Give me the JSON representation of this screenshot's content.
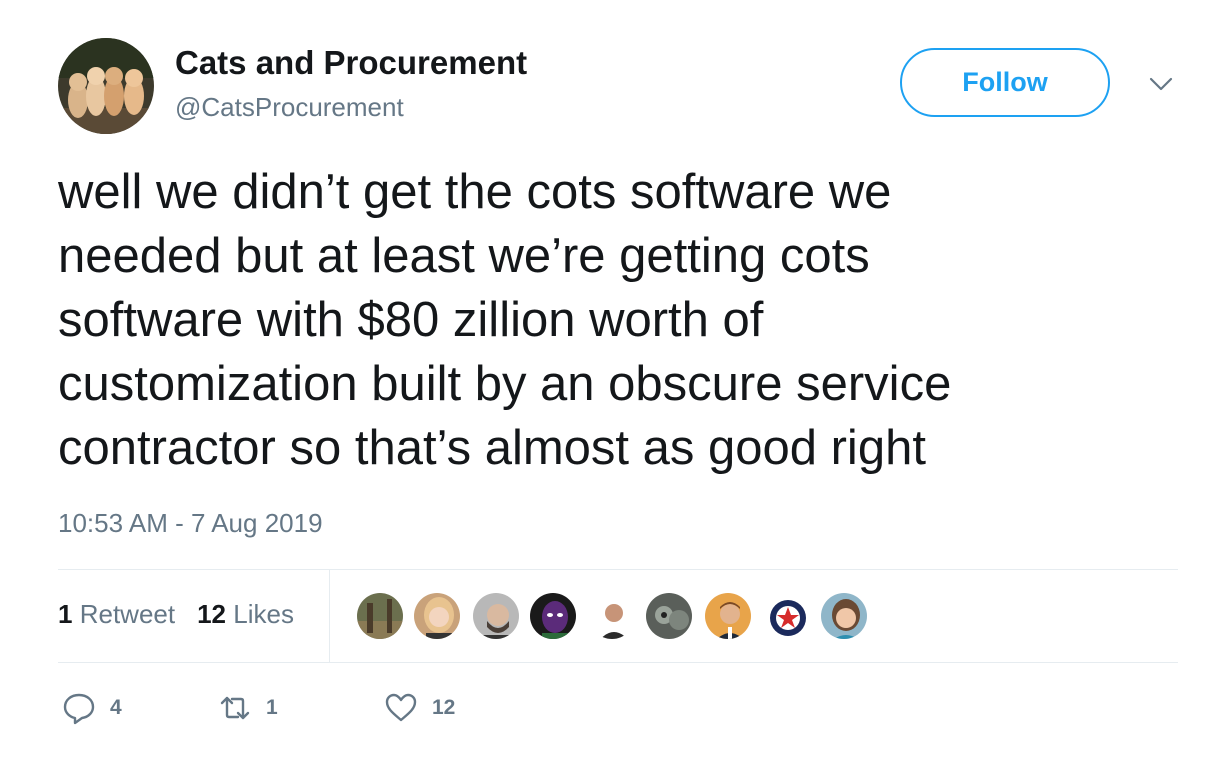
{
  "tweet": {
    "author": {
      "display_name": "Cats and Procurement",
      "handle": "@CatsProcurement",
      "avatar_icon": "cats-avatar-photo"
    },
    "follow_label": "Follow",
    "menu_icon": "chevron-down-icon",
    "text_lines": [
      "well we didn’t get the cots software we",
      "needed but at least we’re getting cots",
      "software with $80 zillion worth of",
      "customization built by an obscure service",
      "contractor so that’s almost as good right"
    ],
    "timestamp": "10:53 AM - 7 Aug 2019",
    "stats": {
      "retweets_count": "1",
      "retweets_label": "Retweet",
      "likes_count": "12",
      "likes_label": "Likes"
    },
    "likers": [
      {
        "icon": "liker-avatar-1"
      },
      {
        "icon": "liker-avatar-2"
      },
      {
        "icon": "liker-avatar-3"
      },
      {
        "icon": "liker-avatar-4"
      },
      {
        "icon": "liker-avatar-5"
      },
      {
        "icon": "liker-avatar-6"
      },
      {
        "icon": "liker-avatar-7"
      },
      {
        "icon": "liker-avatar-8"
      },
      {
        "icon": "liker-avatar-9"
      }
    ],
    "actions": {
      "reply_count": "4",
      "retweet_count": "1",
      "like_count": "12"
    }
  },
  "colors": {
    "accent": "#1da1f2",
    "text": "#14171a",
    "secondary": "#657786",
    "divider": "#e6ecf0"
  }
}
